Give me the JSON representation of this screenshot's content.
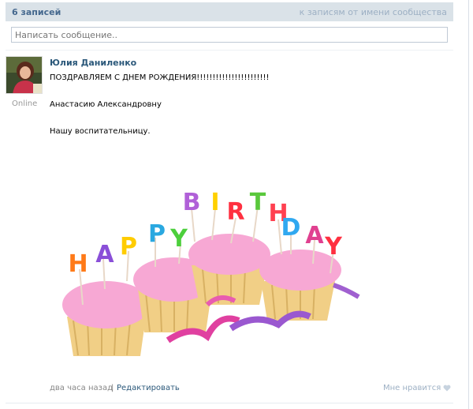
{
  "wall": {
    "count_label": "6 записей",
    "community_link": "к записям от имени сообщества",
    "compose_placeholder": "Написать сообщение.."
  },
  "post": {
    "author": "Юлия Даниленко",
    "status": "Online",
    "lines": [
      "ПОЗДРАВЛЯЕМ С ДНЕМ РОЖДЕНИЯ!!!!!!!!!!!!!!!!!!!!!!!",
      "Анастасию Александровну",
      "Нашу воспитательницу."
    ],
    "image_letters": [
      "H",
      "A",
      "P",
      "P",
      "Y",
      "B",
      "I",
      "R",
      "T",
      "H",
      "D",
      "A",
      "Y"
    ],
    "time": "два часа назад",
    "separator": "|",
    "edit_label": "Редактировать",
    "like_label": "Мне нравится",
    "like_icon": "heart-icon"
  },
  "colors": {
    "header_bg": "#dae2e8",
    "link_blue": "#2b587a",
    "muted": "#9db0c4",
    "frosting": "#f7a8d4",
    "cake": "#f1cf86"
  }
}
